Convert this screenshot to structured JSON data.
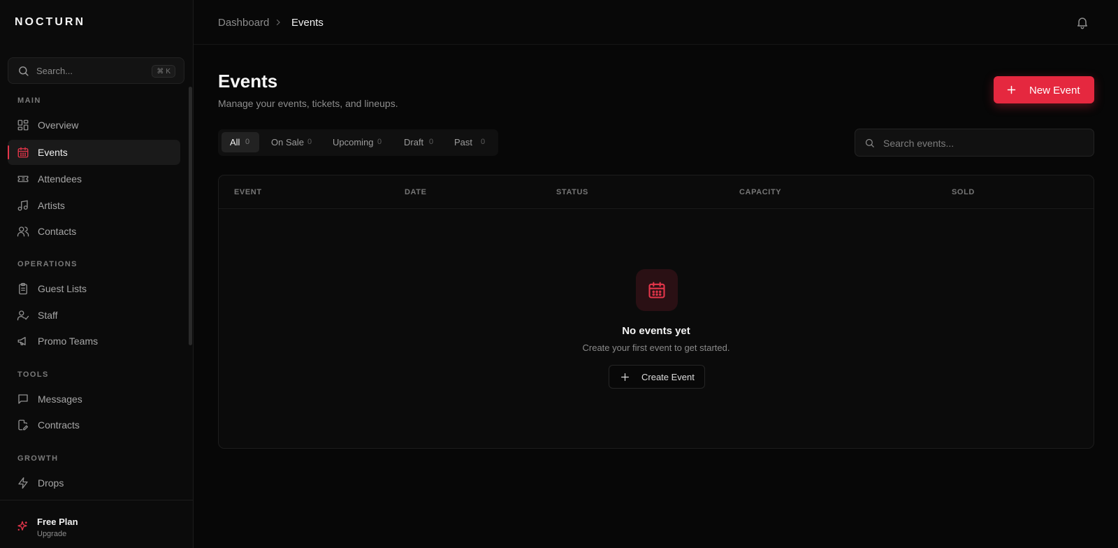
{
  "brand": {
    "name": "NOCTURN",
    "accent": "#e5283f"
  },
  "sidebar": {
    "search": {
      "placeholder": "Search...",
      "shortcut_symbol": "⌘",
      "shortcut_key": "K"
    },
    "sections": [
      {
        "title": "MAIN",
        "items": [
          {
            "label": "Overview",
            "icon": "grid-icon"
          },
          {
            "label": "Events",
            "icon": "calendar-icon",
            "active": true
          },
          {
            "label": "Attendees",
            "icon": "ticket-icon"
          },
          {
            "label": "Artists",
            "icon": "music-icon"
          },
          {
            "label": "Contacts",
            "icon": "users-icon"
          }
        ]
      },
      {
        "title": "OPERATIONS",
        "items": [
          {
            "label": "Guest Lists",
            "icon": "clipboard-icon"
          },
          {
            "label": "Staff",
            "icon": "user-check-icon"
          },
          {
            "label": "Promo Teams",
            "icon": "megaphone-icon"
          }
        ]
      },
      {
        "title": "TOOLS",
        "items": [
          {
            "label": "Messages",
            "icon": "message-icon"
          },
          {
            "label": "Contracts",
            "icon": "file-edit-icon"
          }
        ]
      },
      {
        "title": "GROWTH",
        "items": [
          {
            "label": "Drops",
            "icon": "zap-icon"
          }
        ]
      }
    ],
    "footer": {
      "plan": "Free Plan",
      "action": "Upgrade",
      "icon": "sparkles-icon"
    }
  },
  "header": {
    "breadcrumb": [
      "Dashboard",
      "Events"
    ],
    "notification_icon": "bell-icon"
  },
  "main": {
    "title": "Events",
    "subtitle": "Manage your events, tickets, and lineups.",
    "new_button": "New Event",
    "tabs": [
      {
        "label": "All",
        "count": "0",
        "active": true
      },
      {
        "label": "On Sale",
        "count": "0"
      },
      {
        "label": "Upcoming",
        "count": "0"
      },
      {
        "label": "Draft",
        "count": "0"
      },
      {
        "label": "Past",
        "count": "0"
      }
    ],
    "search_placeholder": "Search events...",
    "table": {
      "columns": [
        "EVENT",
        "DATE",
        "STATUS",
        "CAPACITY",
        "SOLD"
      ],
      "rows": []
    },
    "empty": {
      "title": "No events yet",
      "subtitle": "Create your first event to get started.",
      "button": "Create Event"
    }
  }
}
